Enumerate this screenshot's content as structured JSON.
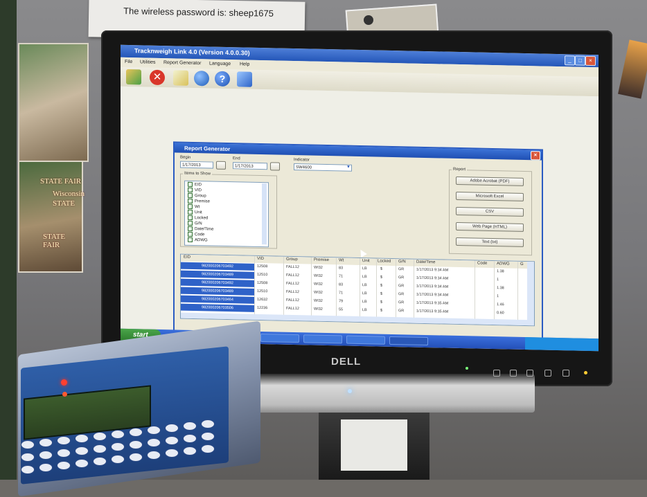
{
  "sticky_note": {
    "text": "The wireless password is: sheep1675"
  },
  "posters": {
    "state_fair_1": "STATE FAIR",
    "wisconsin": "Wisconsin",
    "state": "STATE",
    "state_fair_2": "STATE FAIR"
  },
  "app": {
    "title": "Tracknweigh Link 4.0 (Version 4.0.0.30)",
    "menu": [
      "File",
      "Utilities",
      "Report Generator",
      "Language",
      "Help"
    ]
  },
  "dialog": {
    "title": "Report Generator",
    "begin_label": "Begin",
    "begin_value": "1/17/2013",
    "end_label": "End",
    "end_value": "1/17/2013",
    "indicator_label": "Indicator",
    "indicator_value": "SW4600",
    "items_label": "Items to Show",
    "items": [
      "EID",
      "VID",
      "Group",
      "Premise",
      "Wt",
      "Unit",
      "Locked",
      "G/N",
      "Date/Time",
      "Code",
      "ADWG"
    ],
    "report_label": "Report",
    "report_buttons": [
      "Adobe Acrobat (PDF)",
      "Microsoft Excel",
      "CSV",
      "Web Page (HTML)",
      "Text (txt)"
    ]
  },
  "grid": {
    "columns": [
      "EID",
      "VID",
      "Group",
      "Premise",
      "Wt",
      "Unit",
      "Locked",
      "G/N",
      "Date/Time",
      "Code",
      "ADWG",
      "G"
    ],
    "rows": [
      [
        "982000206703492",
        "12508",
        "FALL12",
        "WI32",
        "83",
        "LB",
        "$",
        "GR",
        "1/17/2013 9:34 AM",
        "",
        "1.38"
      ],
      [
        "982000206703489",
        "12510",
        "FALL12",
        "WI32",
        "71",
        "LB",
        "$",
        "GR",
        "1/17/2013 9:34 AM",
        "",
        "1"
      ],
      [
        "982000206703492",
        "12508",
        "FALL12",
        "WI32",
        "83",
        "LB",
        "$",
        "GR",
        "1/17/2013 9:34 AM",
        "",
        "1.38"
      ],
      [
        "982000206703489",
        "12510",
        "FALL12",
        "WI32",
        "71",
        "LB",
        "$",
        "GR",
        "1/17/2013 9:34 AM",
        "",
        "1"
      ],
      [
        "982000206703464",
        "12632",
        "FALL12",
        "WI32",
        "79",
        "LB",
        "$",
        "GR",
        "1/17/2013 9:35 AM",
        "",
        "1.46"
      ],
      [
        "982000206703506",
        "12236",
        "FALL12",
        "WI32",
        "55",
        "LB",
        "$",
        "GR",
        "1/17/2013 9:35 AM",
        "",
        "0.60"
      ]
    ]
  },
  "taskbar": {
    "start": "start"
  },
  "monitor": {
    "brand": "DELL"
  },
  "colors": {
    "xp_blue": "#2456b8",
    "selection": "#2f62c8",
    "close_red": "#d9573b",
    "start_green": "#2e7d2e"
  }
}
